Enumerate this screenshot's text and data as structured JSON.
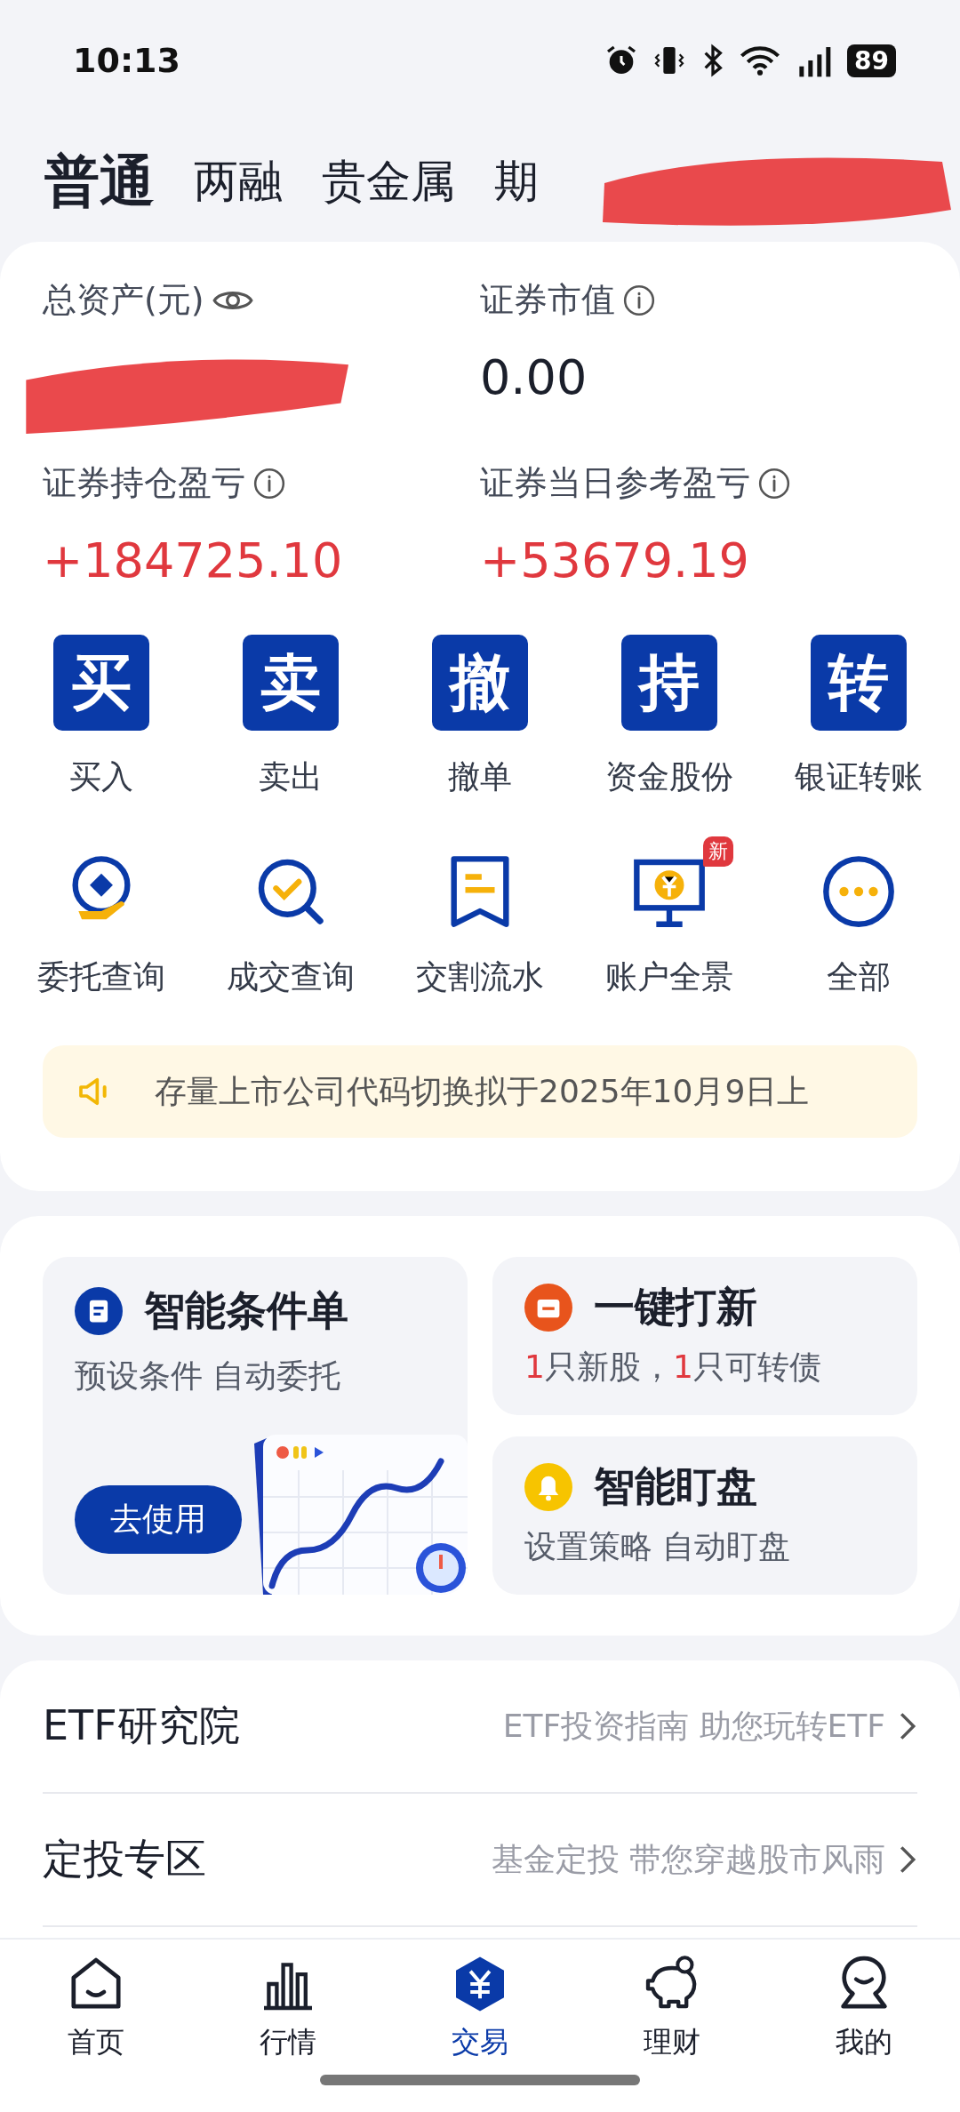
{
  "status_bar": {
    "time": "10:13",
    "battery": "89"
  },
  "account_tabs": [
    {
      "label": "普通",
      "selected": true
    },
    {
      "label": "两融",
      "selected": false
    },
    {
      "label": "贵金属",
      "selected": false
    },
    {
      "label": "期",
      "selected": false
    }
  ],
  "summary": [
    {
      "label": "总资产(元)",
      "kind": "eye",
      "redacted": true
    },
    {
      "label": "证券市值",
      "kind": "info",
      "value": "0.00",
      "positive": false
    },
    {
      "label": "证券持仓盈亏",
      "kind": "info",
      "value": "+184725.10",
      "positive": true
    },
    {
      "label": "证券当日参考盈亏",
      "kind": "info",
      "value": "+53679.19",
      "positive": true
    }
  ],
  "trade_actions": [
    {
      "glyph": "买",
      "label": "买入"
    },
    {
      "glyph": "卖",
      "label": "卖出"
    },
    {
      "glyph": "撤",
      "label": "撤单"
    },
    {
      "glyph": "持",
      "label": "资金股份"
    },
    {
      "glyph": "转",
      "label": "银证转账"
    }
  ],
  "tools": [
    {
      "kind": "order",
      "label": "委托查询"
    },
    {
      "kind": "deal",
      "label": "成交查询"
    },
    {
      "kind": "flow",
      "label": "交割流水"
    },
    {
      "kind": "account",
      "label": "账户全景",
      "badge": "新"
    },
    {
      "kind": "more",
      "label": "全部"
    }
  ],
  "notice": {
    "text": "存量上市公司代码切换拟于2025年10月9日上"
  },
  "features": {
    "main": {
      "title": "智能条件单",
      "subtitle": "预设条件 自动委托",
      "button": "去使用"
    },
    "side": [
      {
        "kind": "ipo",
        "title": "一键打新",
        "subtitle_parts": [
          {
            "text": "1",
            "highlight": true
          },
          {
            "text": "只新股，",
            "highlight": false
          },
          {
            "text": "1",
            "highlight": true
          },
          {
            "text": "只可转债",
            "highlight": false
          }
        ]
      },
      {
        "kind": "bell",
        "title": "智能盯盘",
        "subtitle_parts": [
          {
            "text": "设置策略 自动盯盘",
            "highlight": false
          }
        ]
      }
    ]
  },
  "links": [
    {
      "title": "ETF研究院",
      "subtitle": "ETF投资指南 助您玩转ETF"
    },
    {
      "title": "定投专区",
      "subtitle": "基金定投 带您穿越股市风雨"
    }
  ],
  "bottom_nav": [
    {
      "kind": "home",
      "label": "首页",
      "selected": false
    },
    {
      "kind": "market",
      "label": "行情",
      "selected": false
    },
    {
      "kind": "trade",
      "label": "交易",
      "selected": true
    },
    {
      "kind": "wealth",
      "label": "理财",
      "selected": false
    },
    {
      "kind": "me",
      "label": "我的",
      "selected": false
    }
  ]
}
